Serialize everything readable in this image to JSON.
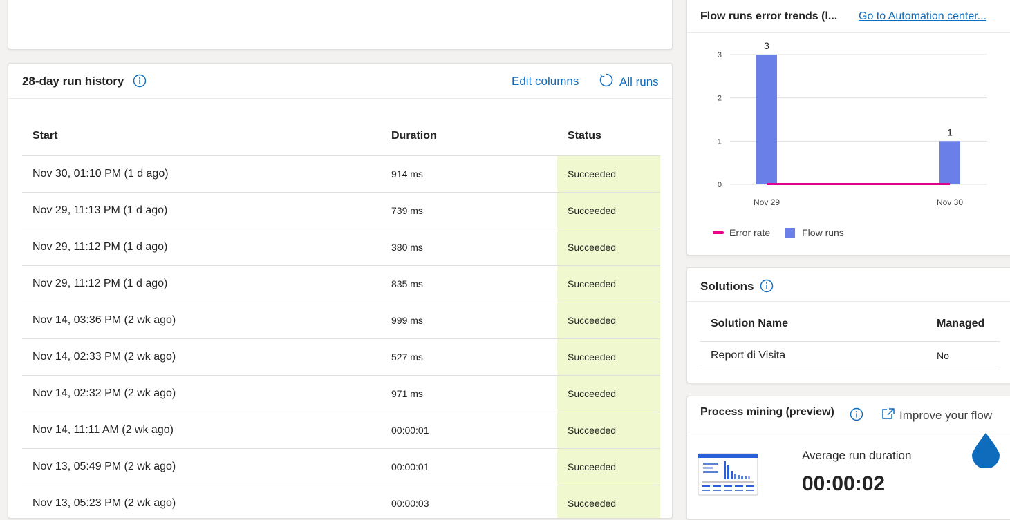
{
  "history": {
    "title": "28-day run history",
    "edit_columns": "Edit columns",
    "all_runs": "All runs",
    "columns": {
      "start": "Start",
      "duration": "Duration",
      "status": "Status"
    },
    "rows": [
      {
        "start": "Nov 30, 01:10 PM (1 d ago)",
        "duration": "914 ms",
        "status": "Succeeded"
      },
      {
        "start": "Nov 29, 11:13 PM (1 d ago)",
        "duration": "739 ms",
        "status": "Succeeded"
      },
      {
        "start": "Nov 29, 11:12 PM (1 d ago)",
        "duration": "380 ms",
        "status": "Succeeded"
      },
      {
        "start": "Nov 29, 11:12 PM (1 d ago)",
        "duration": "835 ms",
        "status": "Succeeded"
      },
      {
        "start": "Nov 14, 03:36 PM (2 wk ago)",
        "duration": "999 ms",
        "status": "Succeeded"
      },
      {
        "start": "Nov 14, 02:33 PM (2 wk ago)",
        "duration": "527 ms",
        "status": "Succeeded"
      },
      {
        "start": "Nov 14, 02:32 PM (2 wk ago)",
        "duration": "971 ms",
        "status": "Succeeded"
      },
      {
        "start": "Nov 14, 11:11 AM (2 wk ago)",
        "duration": "00:00:01",
        "status": "Succeeded"
      },
      {
        "start": "Nov 13, 05:49 PM (2 wk ago)",
        "duration": "00:00:01",
        "status": "Succeeded"
      },
      {
        "start": "Nov 13, 05:23 PM (2 wk ago)",
        "duration": "00:00:03",
        "status": "Succeeded"
      }
    ]
  },
  "trends": {
    "title": "Flow runs error trends (l...",
    "link": "Go to Automation center..."
  },
  "chart_data": {
    "type": "bar",
    "categories": [
      "Nov 29",
      "Nov 30"
    ],
    "series": [
      {
        "name": "Flow runs",
        "values": [
          3,
          1
        ],
        "color": "#6b7fe8"
      },
      {
        "name": "Error rate",
        "values": [
          0,
          0
        ],
        "color": "#e3008c"
      }
    ],
    "data_labels": [
      "3",
      "1"
    ],
    "yticks": [
      "0",
      "1",
      "2",
      "3"
    ],
    "ylim": [
      0,
      3
    ],
    "grid": true,
    "legend": "bottom-left"
  },
  "solutions": {
    "title": "Solutions",
    "col_name": "Solution Name",
    "col_managed": "Managed",
    "rows": [
      {
        "name": "Report di Visita",
        "managed": "No"
      }
    ]
  },
  "mining": {
    "title": "Process mining (preview)",
    "improve": "Improve your flow",
    "avg_label": "Average run duration",
    "avg_value": "00:00:02"
  },
  "colors": {
    "accent": "#0f6cbd",
    "bar": "#6b7fe8",
    "error_line": "#e3008c",
    "success_bg": "#f0f8cf"
  }
}
